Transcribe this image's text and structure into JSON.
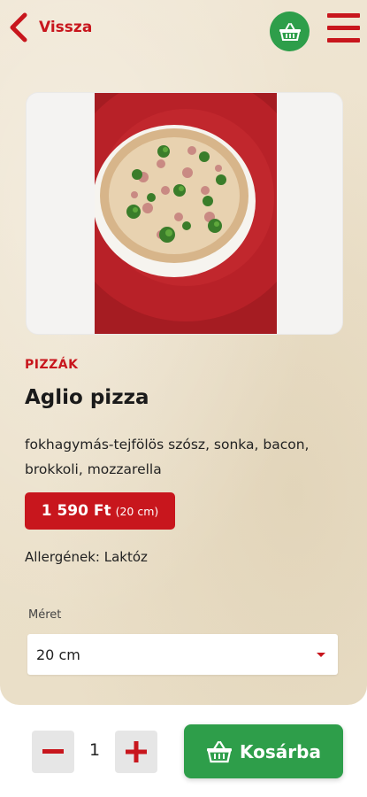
{
  "header": {
    "back_label": "Vissza",
    "back_icon": "chevron-left-icon",
    "cart_icon": "basket-icon",
    "menu_icon": "hamburger-menu-icon"
  },
  "product": {
    "category": "PIZZÁK",
    "name": "Aglio pizza",
    "description": "fokhagymás-tejfölös szósz, sonka, bacon, brokkoli, mozzarella",
    "price": "1 590 Ft",
    "price_size": "(20 cm)",
    "allergens": "Allergének: Laktóz"
  },
  "size_selector": {
    "label": "Méret",
    "selected": "20 cm"
  },
  "order": {
    "quantity": "1",
    "add_label": "Kosárba"
  },
  "colors": {
    "brand_red": "#c8161d",
    "brand_green": "#2e9e4a",
    "background": "#ece1cb"
  }
}
